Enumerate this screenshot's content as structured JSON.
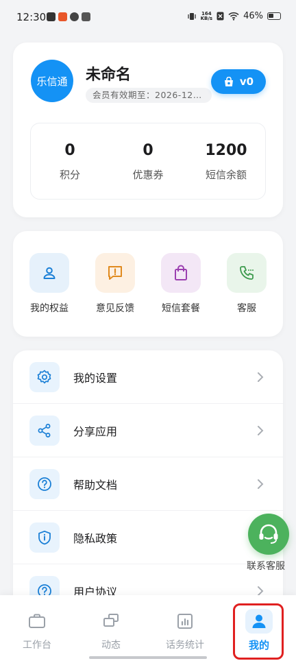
{
  "status_bar": {
    "time": "12:30",
    "net_speed_value": "164",
    "net_speed_unit": "KB/s",
    "battery": "46%"
  },
  "profile": {
    "avatar_text": "乐信通",
    "username": "未命名",
    "expiry": "会员有效期至：2026-12-…",
    "vip_level": "v0",
    "stats": [
      {
        "value": "0",
        "label": "积分"
      },
      {
        "value": "0",
        "label": "优惠券"
      },
      {
        "value": "1200",
        "label": "短信余额"
      }
    ]
  },
  "quick_actions": [
    {
      "label": "我的权益",
      "icon": "user-icon",
      "bg": "#e6f1fb",
      "fg": "#1a7fd6"
    },
    {
      "label": "意见反馈",
      "icon": "feedback-icon",
      "bg": "#fdf0e2",
      "fg": "#e08a1e"
    },
    {
      "label": "短信套餐",
      "icon": "shopping-bag-icon",
      "bg": "#f3e7f6",
      "fg": "#9b3fb0"
    },
    {
      "label": "客服",
      "icon": "phone-icon",
      "bg": "#e9f5ea",
      "fg": "#3c9a4c"
    }
  ],
  "menu": [
    {
      "label": "我的设置",
      "icon": "gear-icon"
    },
    {
      "label": "分享应用",
      "icon": "share-icon"
    },
    {
      "label": "帮助文档",
      "icon": "help-icon"
    },
    {
      "label": "隐私政策",
      "icon": "shield-icon"
    },
    {
      "label": "用户协议",
      "icon": "help-icon"
    }
  ],
  "fab": {
    "label": "联系客服",
    "icon": "headset-icon"
  },
  "tabs": [
    {
      "label": "工作台",
      "icon": "briefcase-icon",
      "active": false
    },
    {
      "label": "动态",
      "icon": "layers-icon",
      "active": false
    },
    {
      "label": "话务统计",
      "icon": "bar-chart-icon",
      "active": false
    },
    {
      "label": "我的",
      "icon": "person-icon",
      "active": true
    }
  ],
  "colors": {
    "accent": "#1492f5",
    "highlight": "#e02020",
    "fab": "#4cb25d"
  }
}
